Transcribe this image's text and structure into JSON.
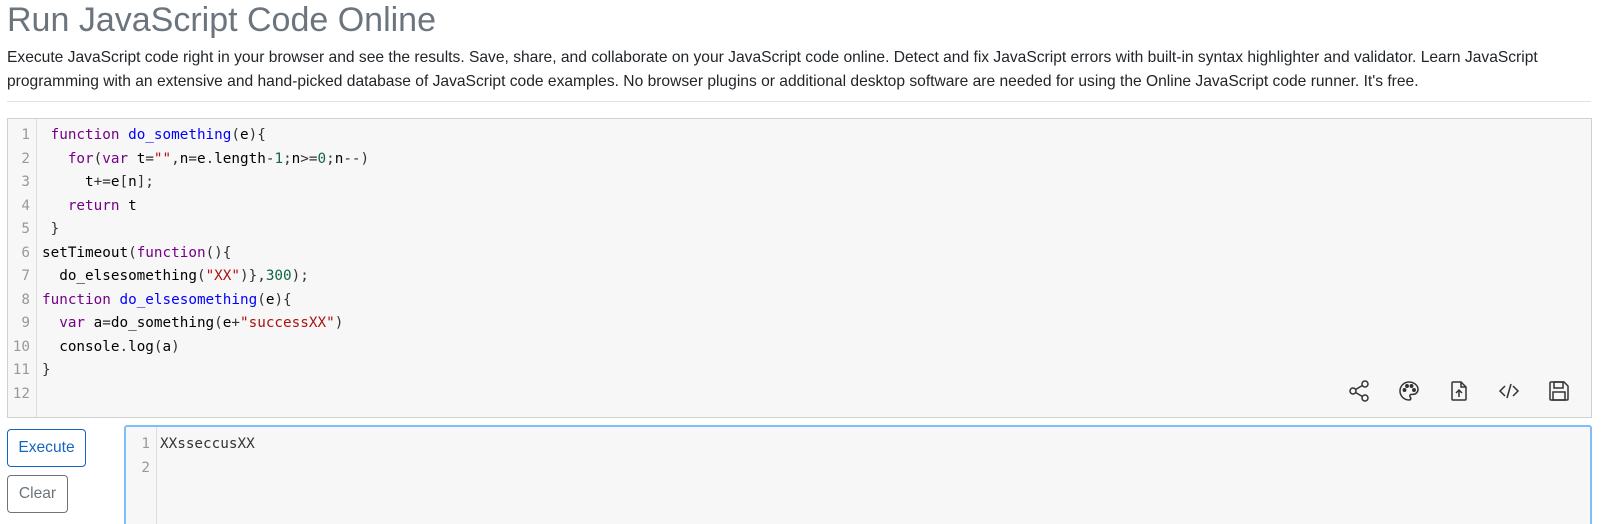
{
  "page": {
    "title": "Run JavaScript Code Online",
    "description": "Execute JavaScript code right in your browser and see the results. Save, share, and collaborate on your JavaScript code online. Detect and fix JavaScript errors with built-in syntax highlighter and validator. Learn JavaScript programming with an extensive and hand-picked database of JavaScript code examples. No browser plugins or additional desktop software are needed for using the Online JavaScript code runner. It's free."
  },
  "editor": {
    "line_numbers": [
      "1",
      "2",
      "3",
      "4",
      "5",
      "6",
      "7",
      "8",
      "9",
      "10",
      "11",
      "12"
    ],
    "code_lines": [
      " function do_something(e){",
      "   for(var t=\"\",n=e.length-1;n>=0;n--)",
      "     t+=e[n];",
      "   return t",
      " }",
      "setTimeout(function(){",
      "  do_elsesomething(\"XX\")},300);",
      "function do_elsesomething(e){",
      "  var a=do_something(e+\"successXX\")",
      "  console.log(a)",
      "}",
      ""
    ]
  },
  "toolbar": {
    "icons": [
      "share-icon",
      "palette-icon",
      "upload-icon",
      "code-icon",
      "save-icon"
    ]
  },
  "buttons": {
    "execute_label": "Execute",
    "clear_label": "Clear"
  },
  "output": {
    "line_numbers": [
      "1",
      "2"
    ],
    "lines": [
      "XXsseccusXX",
      ""
    ]
  },
  "colors": {
    "primary": "#1565c0",
    "secondary": "#6c757d",
    "focus_border": "#80bdff",
    "editor_bg": "#f7f7f7"
  }
}
